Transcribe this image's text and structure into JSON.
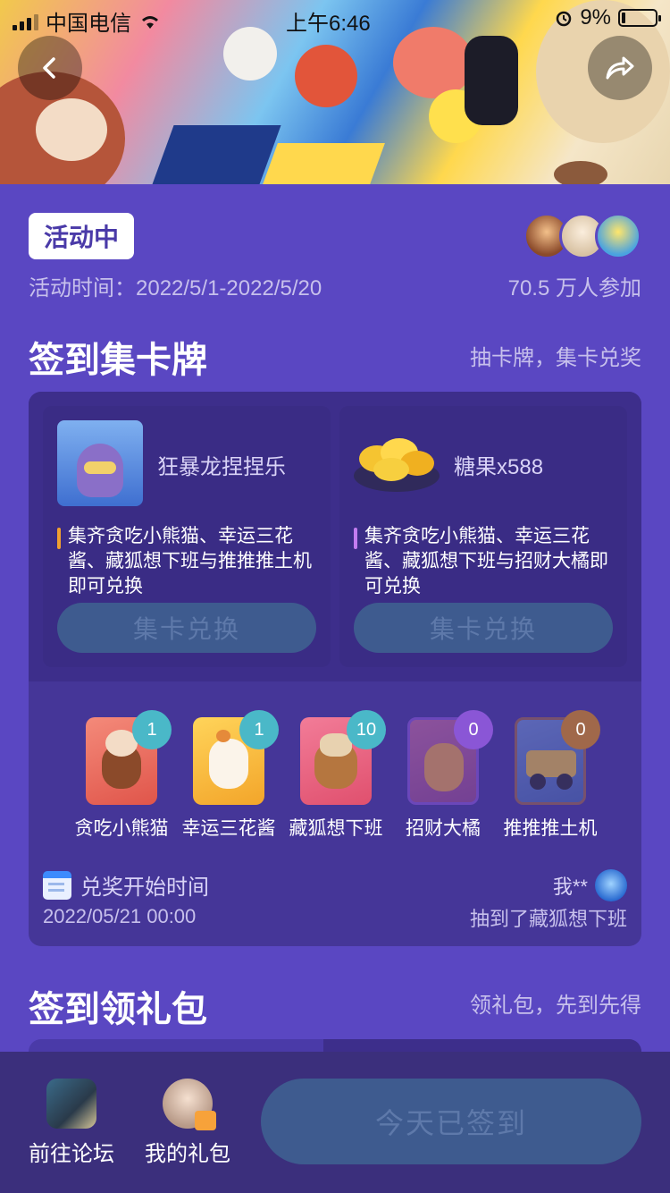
{
  "status_bar": {
    "carrier": "中国电信",
    "time": "上午6:46",
    "battery": "9%"
  },
  "status": {
    "badge": "活动中",
    "time_range": "活动时间：2022/5/1-2022/5/20",
    "participants": "70.5 万人参加"
  },
  "section1": {
    "title": "签到集卡牌",
    "subtitle": "抽卡牌，集卡兑奖"
  },
  "rewards": [
    {
      "name": "狂暴龙捏捏乐",
      "desc": "集齐贪吃小熊猫、幸运三花酱、藏狐想下班与推推推土机即可兑换",
      "button": "集卡兑换",
      "bar_color": "#f0a030"
    },
    {
      "name": "糖果x588",
      "desc": "集齐贪吃小熊猫、幸运三花酱、藏狐想下班与招财大橘即可兑换",
      "button": "集卡兑换",
      "bar_color": "#c37cf0"
    }
  ],
  "cards": [
    {
      "name": "贪吃小熊猫",
      "count": "1",
      "count_color": "#4ab8c8",
      "owned": true
    },
    {
      "name": "幸运三花酱",
      "count": "1",
      "count_color": "#4ab8c8",
      "owned": true
    },
    {
      "name": "藏狐想下班",
      "count": "10",
      "count_color": "#4ab8c8",
      "owned": true
    },
    {
      "name": "招财大橘",
      "count": "0",
      "count_color": "#8a56d6",
      "owned": false
    },
    {
      "name": "推推推土机",
      "count": "0",
      "count_color": "#a0684a",
      "owned": false
    }
  ],
  "redeem": {
    "label": "兑奖开始时间",
    "date": "2022/05/21 00:00",
    "drawer_name": "我**",
    "drawer_text": "抽到了藏狐想下班"
  },
  "section2": {
    "title": "签到领礼包",
    "subtitle": "领礼包，先到先得"
  },
  "bottom": {
    "forum": "前往论坛",
    "gifts": "我的礼包",
    "signed": "今天已签到"
  }
}
